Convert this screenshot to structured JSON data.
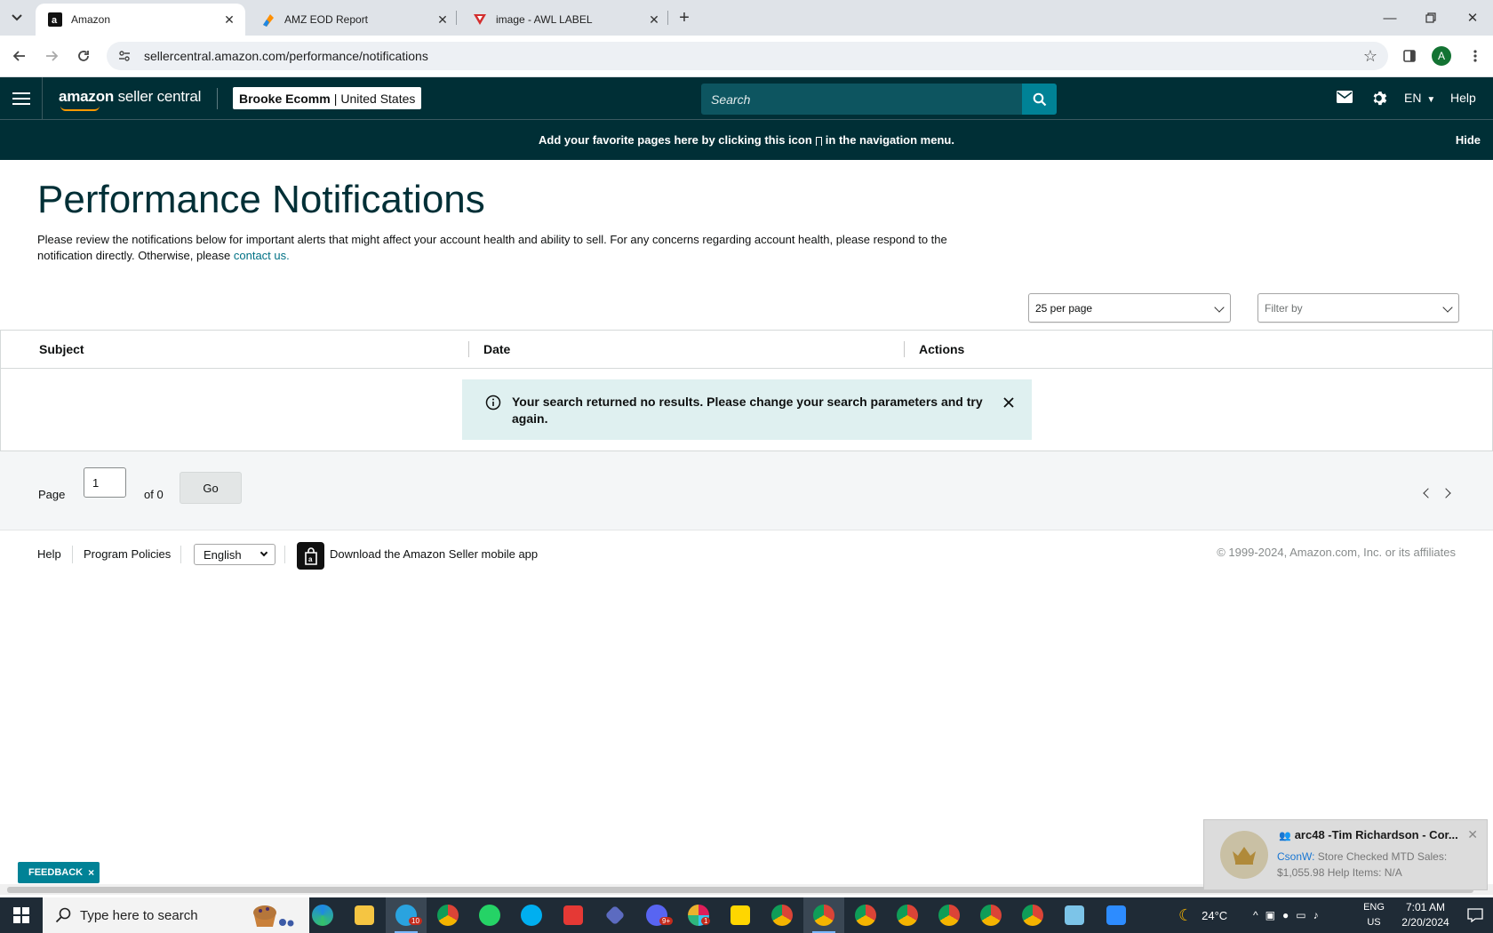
{
  "browser": {
    "tabs": [
      {
        "title": "Amazon",
        "active": true
      },
      {
        "title": "AMZ EOD Report",
        "active": false
      },
      {
        "title": "image - AWL LABEL",
        "active": false
      }
    ],
    "url": "sellercentral.amazon.com/performance/notifications",
    "profile_initial": "A"
  },
  "header": {
    "logo_bold": "amazon",
    "logo_rest": " seller central",
    "account_name": "Brooke Ecomm",
    "account_sep": "|",
    "account_region": "United States",
    "search_placeholder": "Search",
    "language": "EN",
    "help": "Help"
  },
  "banner": {
    "text_before": "Add your favorite pages here by clicking this icon",
    "text_after": "in the navigation menu.",
    "hide": "Hide"
  },
  "page": {
    "title": "Performance Notifications",
    "intro": "Please review the notifications below for important alerts that might affect your account health and ability to sell. For any concerns regarding account health, please respond to the notification directly. Otherwise, please ",
    "contact_link": "contact us.",
    "per_page": "25 per page",
    "filter_placeholder": "Filter by"
  },
  "table": {
    "columns": [
      "Subject",
      "Date",
      "Actions"
    ],
    "empty_message": "Your search returned no results. Please change your search parameters and try again."
  },
  "pager": {
    "page_label": "Page",
    "current_page": "1",
    "of_label": "of 0",
    "go": "Go"
  },
  "footer": {
    "help": "Help",
    "program_policies": "Program Policies",
    "language": "English",
    "app_download": "Download the Amazon Seller mobile app",
    "copyright": "© 1999-2024, Amazon.com, Inc. or its affiliates"
  },
  "feedback": {
    "label": "FEEDBACK",
    "close": "×"
  },
  "toast": {
    "title": "arc48 -Tim Richardson - Cor...",
    "sender": "CsonW:",
    "body": " Store Checked MTD Sales: $1,055.98 Help Items: N/A"
  },
  "taskbar": {
    "search_placeholder": "Type here to search",
    "weather": "24°C",
    "lang_line1": "ENG",
    "lang_line2": "US",
    "time": "7:01 AM",
    "date": "2/20/2024",
    "badges": {
      "telegram": "10",
      "discord": "9+",
      "slack": "1"
    }
  },
  "colors": {
    "header_bg": "#002f36",
    "search_btn": "#008296",
    "link": "#007185",
    "alert_bg": "#dff0f0"
  }
}
